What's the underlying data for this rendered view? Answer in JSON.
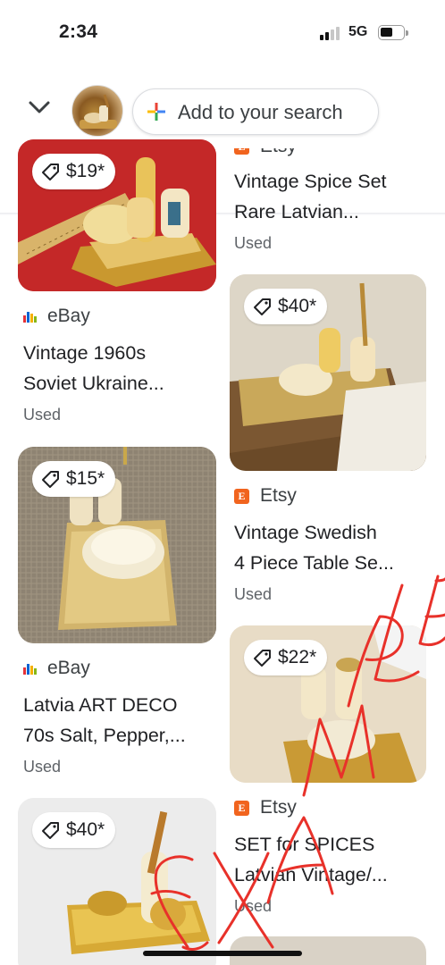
{
  "status_bar": {
    "time": "2:34",
    "network": "5G"
  },
  "search": {
    "add_label": "Add to your search"
  },
  "colors": {
    "etsy": "#f1641e",
    "annotation": "#e8312a",
    "brand_blue": "#4285f4",
    "brand_red": "#ea4335",
    "brand_yellow": "#fbbc05",
    "brand_green": "#34a853"
  },
  "annotation_text": "EXAMPLE",
  "cards": [
    {
      "price": "$19*",
      "source": "eBay",
      "title_line1": "Vintage 1960s",
      "title_line2": "Soviet Ukraine...",
      "condition": "Used"
    },
    {
      "price": "$15*",
      "source": "eBay",
      "title_line1": "Latvia ART DECO",
      "title_line2": "70s Salt, Pepper,...",
      "condition": "Used"
    },
    {
      "price": "$40*",
      "source": "",
      "title_line1": "",
      "title_line2": "",
      "condition": ""
    },
    {
      "price": "",
      "source": "Etsy",
      "title_line1": "Vintage Spice Set",
      "title_line2": "Rare Latvian...",
      "condition": "Used"
    },
    {
      "price": "$40*",
      "source": "Etsy",
      "title_line1": "Vintage Swedish",
      "title_line2": "4 Piece Table Se...",
      "condition": "Used"
    },
    {
      "price": "$22*",
      "source": "Etsy",
      "title_line1": "SET for SPICES",
      "title_line2": "Latvian Vintage/...",
      "condition": "Used"
    }
  ]
}
